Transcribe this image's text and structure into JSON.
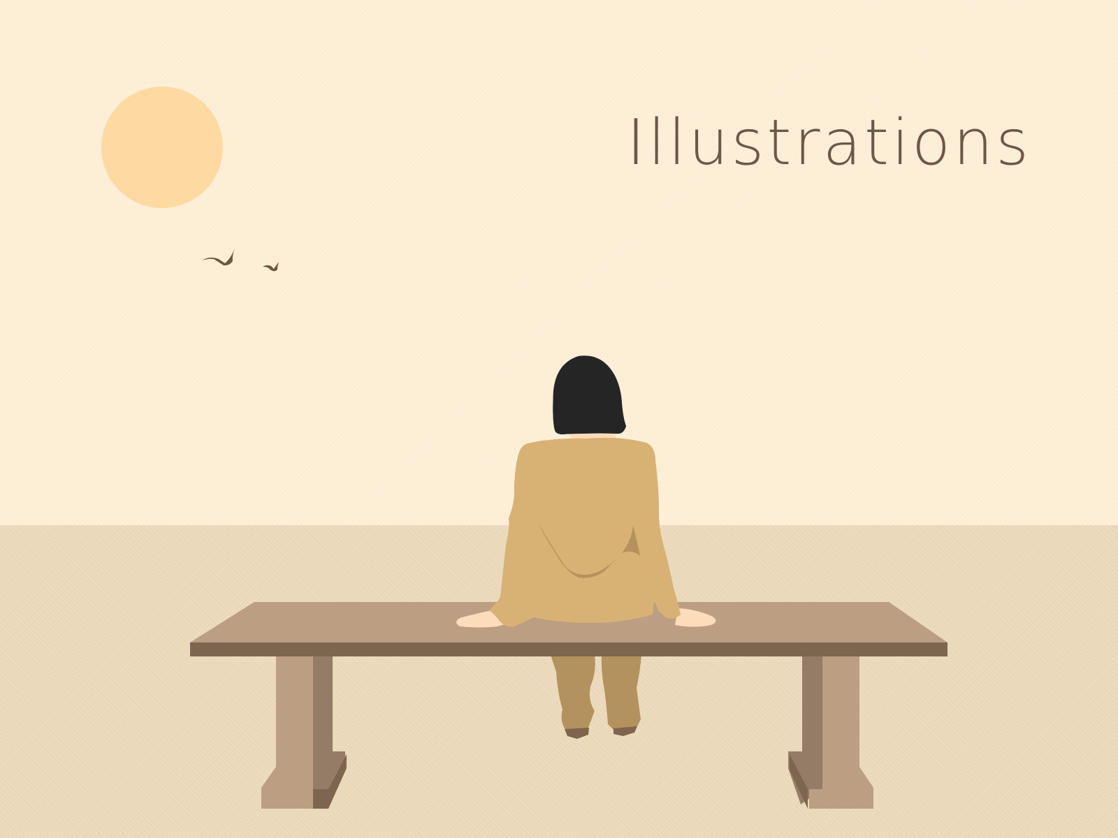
{
  "title": "Illustrations",
  "colors": {
    "sky": "#fdefd8",
    "ground": "#ecdbbd",
    "sun": "#fedaa2",
    "title_text": "#6b5846",
    "bird": "#6e5640",
    "hair": "#252525",
    "jacket": "#d8b274",
    "trousers": "#b4925e",
    "skin": "#fddcbc",
    "bench_top": "#bc9e83",
    "bench_edge": "#7d654f",
    "bench_leg_light": "#bc9e83",
    "bench_leg_dark": "#957c67"
  },
  "icons": [
    "sun",
    "bird",
    "bird",
    "person-seated",
    "bench"
  ]
}
